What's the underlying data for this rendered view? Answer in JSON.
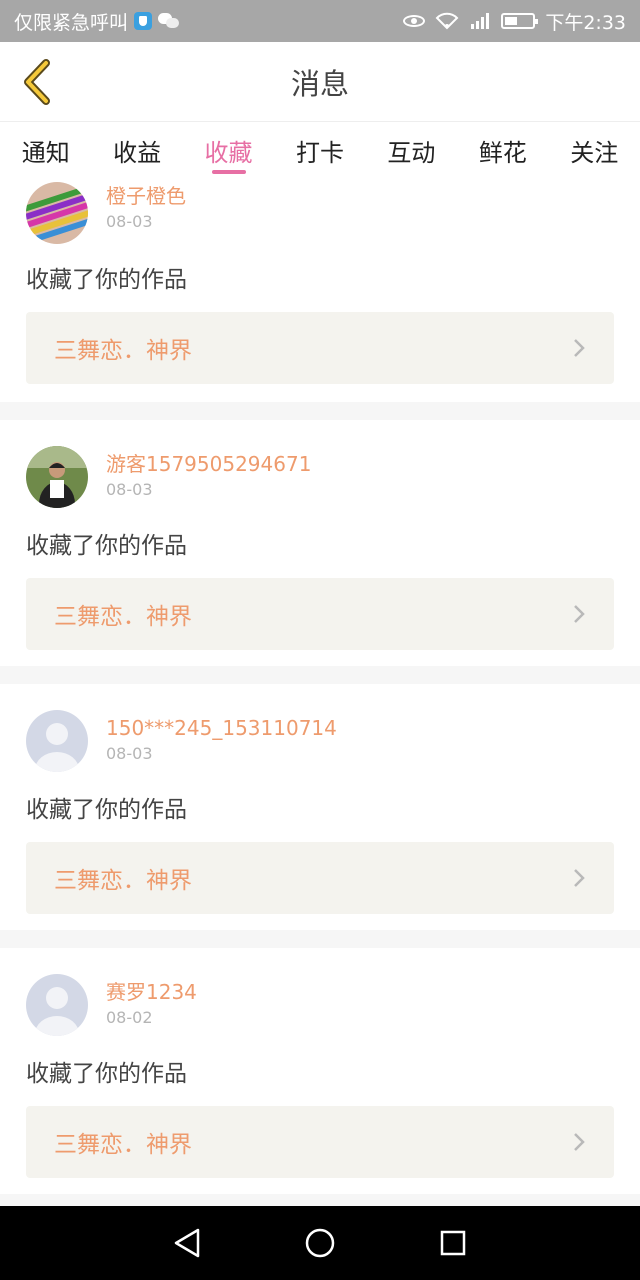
{
  "status_bar": {
    "carrier_text": "仅限紧急呼叫",
    "time": "下午2:33"
  },
  "header": {
    "title": "消息",
    "accent_color": "#e76fa4"
  },
  "tabs": [
    {
      "label": "通知",
      "active": false
    },
    {
      "label": "收益",
      "active": false
    },
    {
      "label": "收藏",
      "active": true
    },
    {
      "label": "打卡",
      "active": false
    },
    {
      "label": "互动",
      "active": false
    },
    {
      "label": "鲜花",
      "active": false
    },
    {
      "label": "关注",
      "active": false
    }
  ],
  "items": [
    {
      "username": "橙子橙色",
      "date": "08-03",
      "action": "收藏了你的作品",
      "work_title": "三舞恋．神界",
      "avatar": "pencils-photo"
    },
    {
      "username": "游客1579505294671",
      "date": "08-03",
      "action": "收藏了你的作品",
      "work_title": "三舞恋．神界",
      "avatar": "person-photo"
    },
    {
      "username": "150***245_153110714",
      "date": "08-03",
      "action": "收藏了你的作品",
      "work_title": "三舞恋．神界",
      "avatar": "default-avatar"
    },
    {
      "username": "赛罗1234",
      "date": "08-02",
      "action": "收藏了你的作品",
      "work_title": "三舞恋．神界",
      "avatar": "default-avatar"
    }
  ]
}
